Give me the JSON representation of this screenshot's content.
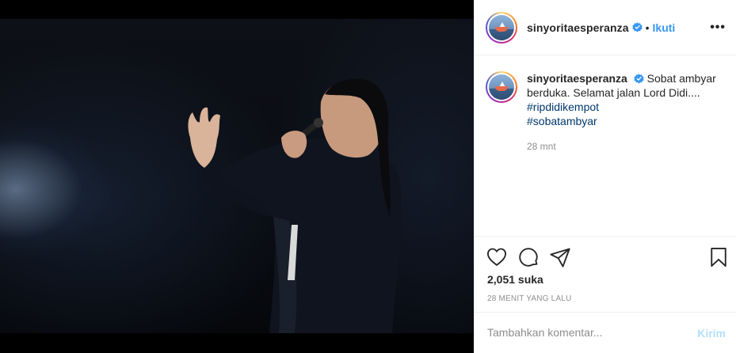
{
  "post": {
    "username": "sinyoritaesperanza",
    "follow_label": "Ikuti",
    "separator": "•",
    "more_label": "•••",
    "caption_text": "Sobat ambyar berduka. Selamat jalan Lord Didi....",
    "hashtags": [
      "#ripdidikempot",
      "#sobatambyar"
    ],
    "caption_time": "28 mnt",
    "likes": "2,051 suka",
    "timestamp": "28 MENIT YANG LALU",
    "comment_placeholder": "Tambahkan komentar...",
    "post_label": "Kirim"
  },
  "icons": {
    "like": "heart-icon",
    "comment": "comment-icon",
    "share": "share-icon",
    "save": "bookmark-icon",
    "verified": "verified-badge-icon"
  },
  "colors": {
    "link_blue": "#3897f0",
    "hashtag": "#00376b",
    "muted": "#8e8e8e",
    "post_disabled": "#b2dffc",
    "verified": "#3897f0"
  }
}
